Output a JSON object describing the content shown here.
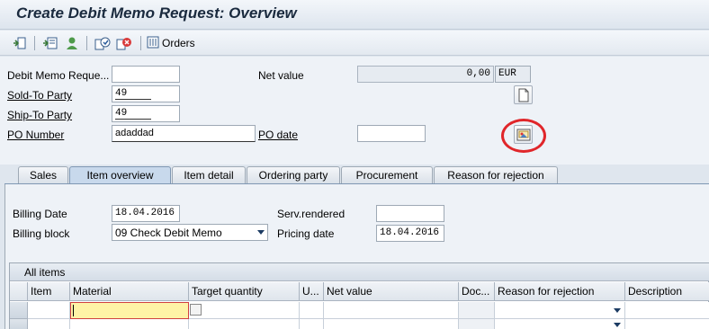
{
  "title": "Create Debit Memo Request: Overview",
  "toolbar": {
    "orders_label": "Orders",
    "icons": [
      "display-doc-flow-icon",
      "header-details-icon",
      "business-partner-icon",
      "check-icon",
      "cancel-icon",
      "orders-icon"
    ]
  },
  "header": {
    "debit_memo_label": "Debit Memo Reque...",
    "debit_memo_value": "",
    "sold_to_label": "Sold-To Party",
    "sold_to_value": "49",
    "ship_to_label": "Ship-To Party",
    "ship_to_value": "49",
    "po_number_label": "PO Number",
    "po_number_value": "adaddad",
    "net_value_label": "Net value",
    "net_value_value": "0,00",
    "currency": "EUR",
    "po_date_label": "PO date",
    "po_date_value": ""
  },
  "tabs": [
    "Sales",
    "Item overview",
    "Item detail",
    "Ordering party",
    "Procurement",
    "Reason for rejection"
  ],
  "active_tab": "Item overview",
  "item_overview": {
    "billing_date_label": "Billing Date",
    "billing_date_value": "18.04.2016",
    "billing_block_label": "Billing block",
    "billing_block_value": "09 Check Debit Memo",
    "serv_rendered_label": "Serv.rendered",
    "serv_rendered_value": "",
    "pricing_date_label": "Pricing date",
    "pricing_date_value": "18.04.2016"
  },
  "table": {
    "caption": "All items",
    "columns": [
      "Item",
      "Material",
      "Target quantity",
      "U...",
      "Net value",
      "Doc...",
      "Reason for rejection",
      "Description"
    ]
  },
  "colors": {
    "annotation_circle": "#e0262a",
    "active_tab": "#c8d9ec",
    "title": "#1a2a3e"
  }
}
